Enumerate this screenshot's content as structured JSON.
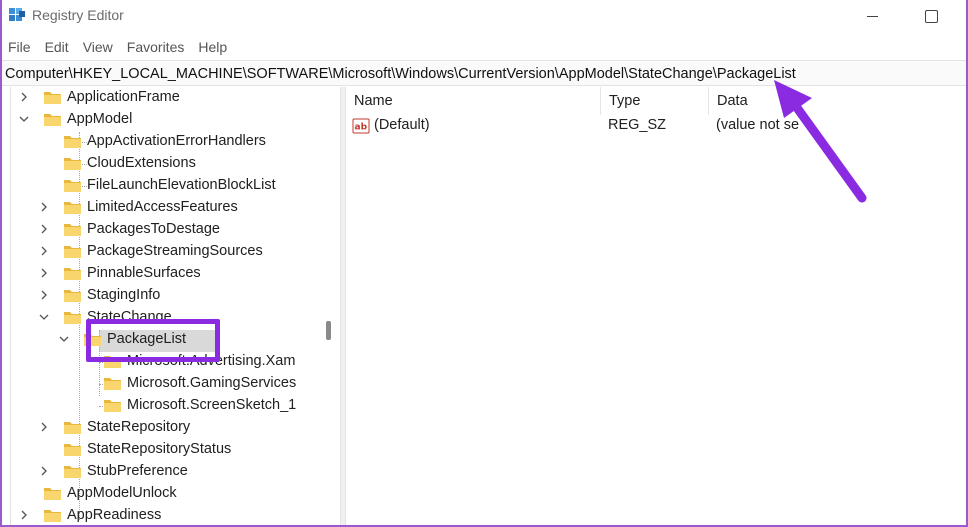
{
  "window": {
    "title": "Registry Editor",
    "accent": "#8a2be2"
  },
  "menu": [
    "File",
    "Edit",
    "View",
    "Favorites",
    "Help"
  ],
  "address": {
    "value": "Computer\\HKEY_LOCAL_MACHINE\\SOFTWARE\\Microsoft\\Windows\\CurrentVersion\\AppModel\\StateChange\\PackageList"
  },
  "tree": {
    "items": [
      {
        "label": "ApplicationFrame",
        "state": "collapsed"
      },
      {
        "label": "AppModel",
        "state": "expanded"
      },
      {
        "label": "AppActivationErrorHandlers",
        "state": "leaf"
      },
      {
        "label": "CloudExtensions",
        "state": "leaf"
      },
      {
        "label": "FileLaunchElevationBlockList",
        "state": "leaf"
      },
      {
        "label": "LimitedAccessFeatures",
        "state": "collapsed"
      },
      {
        "label": "PackagesToDestage",
        "state": "collapsed"
      },
      {
        "label": "PackageStreamingSources",
        "state": "collapsed"
      },
      {
        "label": "PinnableSurfaces",
        "state": "collapsed"
      },
      {
        "label": "StagingInfo",
        "state": "collapsed"
      },
      {
        "label": "StateChange",
        "state": "expanded"
      },
      {
        "label": "PackageList",
        "state": "expanded",
        "selected": true
      },
      {
        "label": "Microsoft.Advertising.Xam",
        "state": "leaf"
      },
      {
        "label": "Microsoft.GamingServices",
        "state": "leaf"
      },
      {
        "label": "Microsoft.ScreenSketch_1",
        "state": "leaf"
      },
      {
        "label": "StateRepository",
        "state": "collapsed"
      },
      {
        "label": "StateRepositoryStatus",
        "state": "leaf"
      },
      {
        "label": "StubPreference",
        "state": "collapsed"
      },
      {
        "label": "AppModelUnlock",
        "state": "leaf"
      },
      {
        "label": "AppReadiness",
        "state": "collapsed"
      }
    ]
  },
  "values_pane": {
    "columns": {
      "name": "Name",
      "type": "Type",
      "data": "Data"
    },
    "rows": [
      {
        "name": "(Default)",
        "type": "REG_SZ",
        "data": "(value not se",
        "icon": "string-value-icon"
      }
    ]
  }
}
